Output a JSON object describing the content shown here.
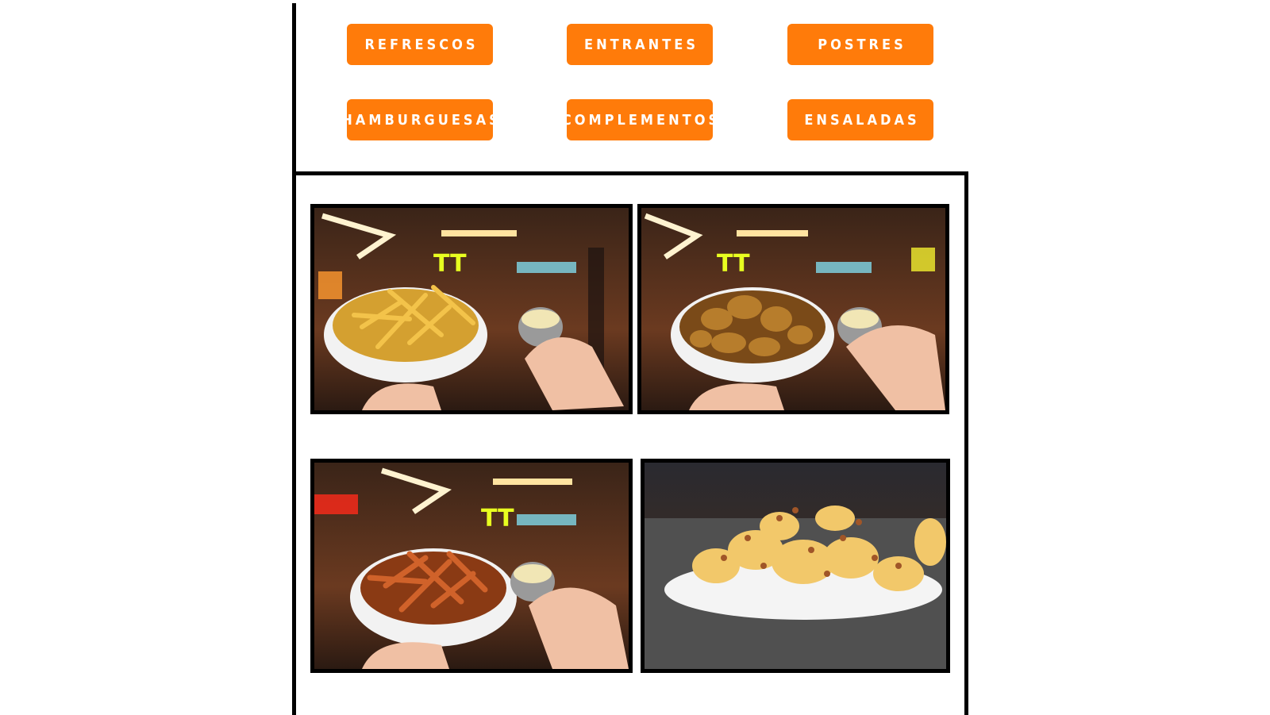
{
  "menu": {
    "categories": [
      {
        "label": "REFRESCOS"
      },
      {
        "label": "ENTRANTES"
      },
      {
        "label": "POSTRES"
      },
      {
        "label": "HAMBURGUESAS"
      },
      {
        "label": "COMPLEMENTOS"
      },
      {
        "label": "ENSALADAS"
      }
    ]
  },
  "colors": {
    "button_bg": "#ff7b0a",
    "button_text": "#ffffff",
    "frame": "#000000"
  },
  "gallery": {
    "photos": [
      {
        "icon": "fries-bowl-photo"
      },
      {
        "icon": "potato-wedges-photo"
      },
      {
        "icon": "sweet-potato-fries-photo"
      },
      {
        "icon": "loaded-potatoes-photo"
      }
    ]
  }
}
